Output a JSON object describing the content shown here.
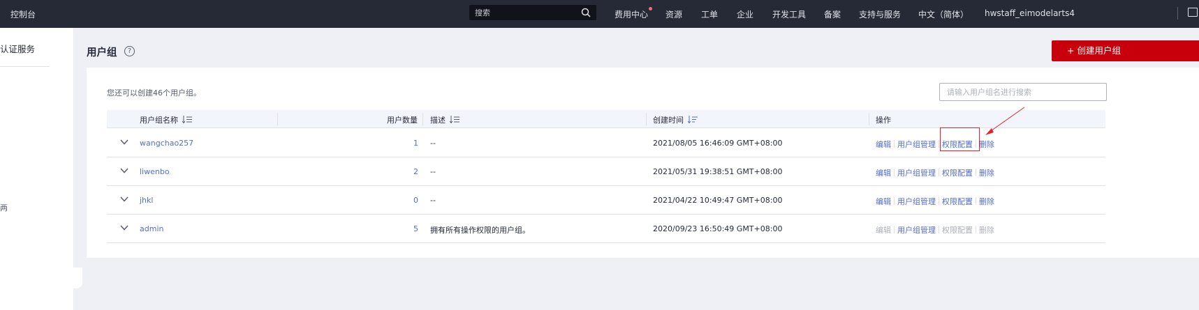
{
  "topbar": {
    "brand": "控制台",
    "search_placeholder": "搜索",
    "nav": [
      "费用中心",
      "资源",
      "工单",
      "企业",
      "开发工具",
      "备案",
      "支持与服务",
      "中文（简体）",
      "hwstaff_eimodelarts4"
    ],
    "billing_badge_color": "#f66f6a"
  },
  "sidebar": {
    "title": "认证服务",
    "fragment": "两"
  },
  "page": {
    "title": "用户组",
    "help_icon": "?",
    "create_button": "+ 创建用户组",
    "quota_text": "您还可以创建46个用户组。",
    "search_placeholder": "请输入用户组名进行搜索"
  },
  "table": {
    "headers": {
      "name": "用户组名称",
      "count": "用户数量",
      "desc": "描述",
      "created": "创建时间",
      "ops": "操作"
    },
    "rows": [
      {
        "name": "wangchao257",
        "count": "1",
        "desc": "--",
        "created": "2021/08/05 16:46:09 GMT+08:00",
        "ops": [
          "编辑",
          "用户组管理",
          "权限配置",
          "删除"
        ]
      },
      {
        "name": "liwenbo",
        "count": "2",
        "desc": "--",
        "created": "2021/05/31 19:38:51 GMT+08:00",
        "ops": [
          "编辑",
          "用户组管理",
          "权限配置",
          "删除"
        ]
      },
      {
        "name": "jhkl",
        "count": "0",
        "desc": "--",
        "created": "2021/04/22 10:49:47 GMT+08:00",
        "ops": [
          "编辑",
          "用户组管理",
          "权限配置",
          "删除"
        ]
      },
      {
        "name": "admin",
        "count": "5",
        "desc": "拥有所有操作权限的用户组。",
        "created": "2020/09/23 16:50:49 GMT+08:00",
        "ops": [
          "编辑",
          "用户组管理",
          "权限配置",
          "删除"
        ],
        "disabled_ops": [
          0,
          2,
          3
        ]
      }
    ]
  },
  "colors": {
    "topbar_bg": "#252a36",
    "link": "#526ecc",
    "brand_red": "#c7000b",
    "annotation_red": "#e2232b"
  }
}
